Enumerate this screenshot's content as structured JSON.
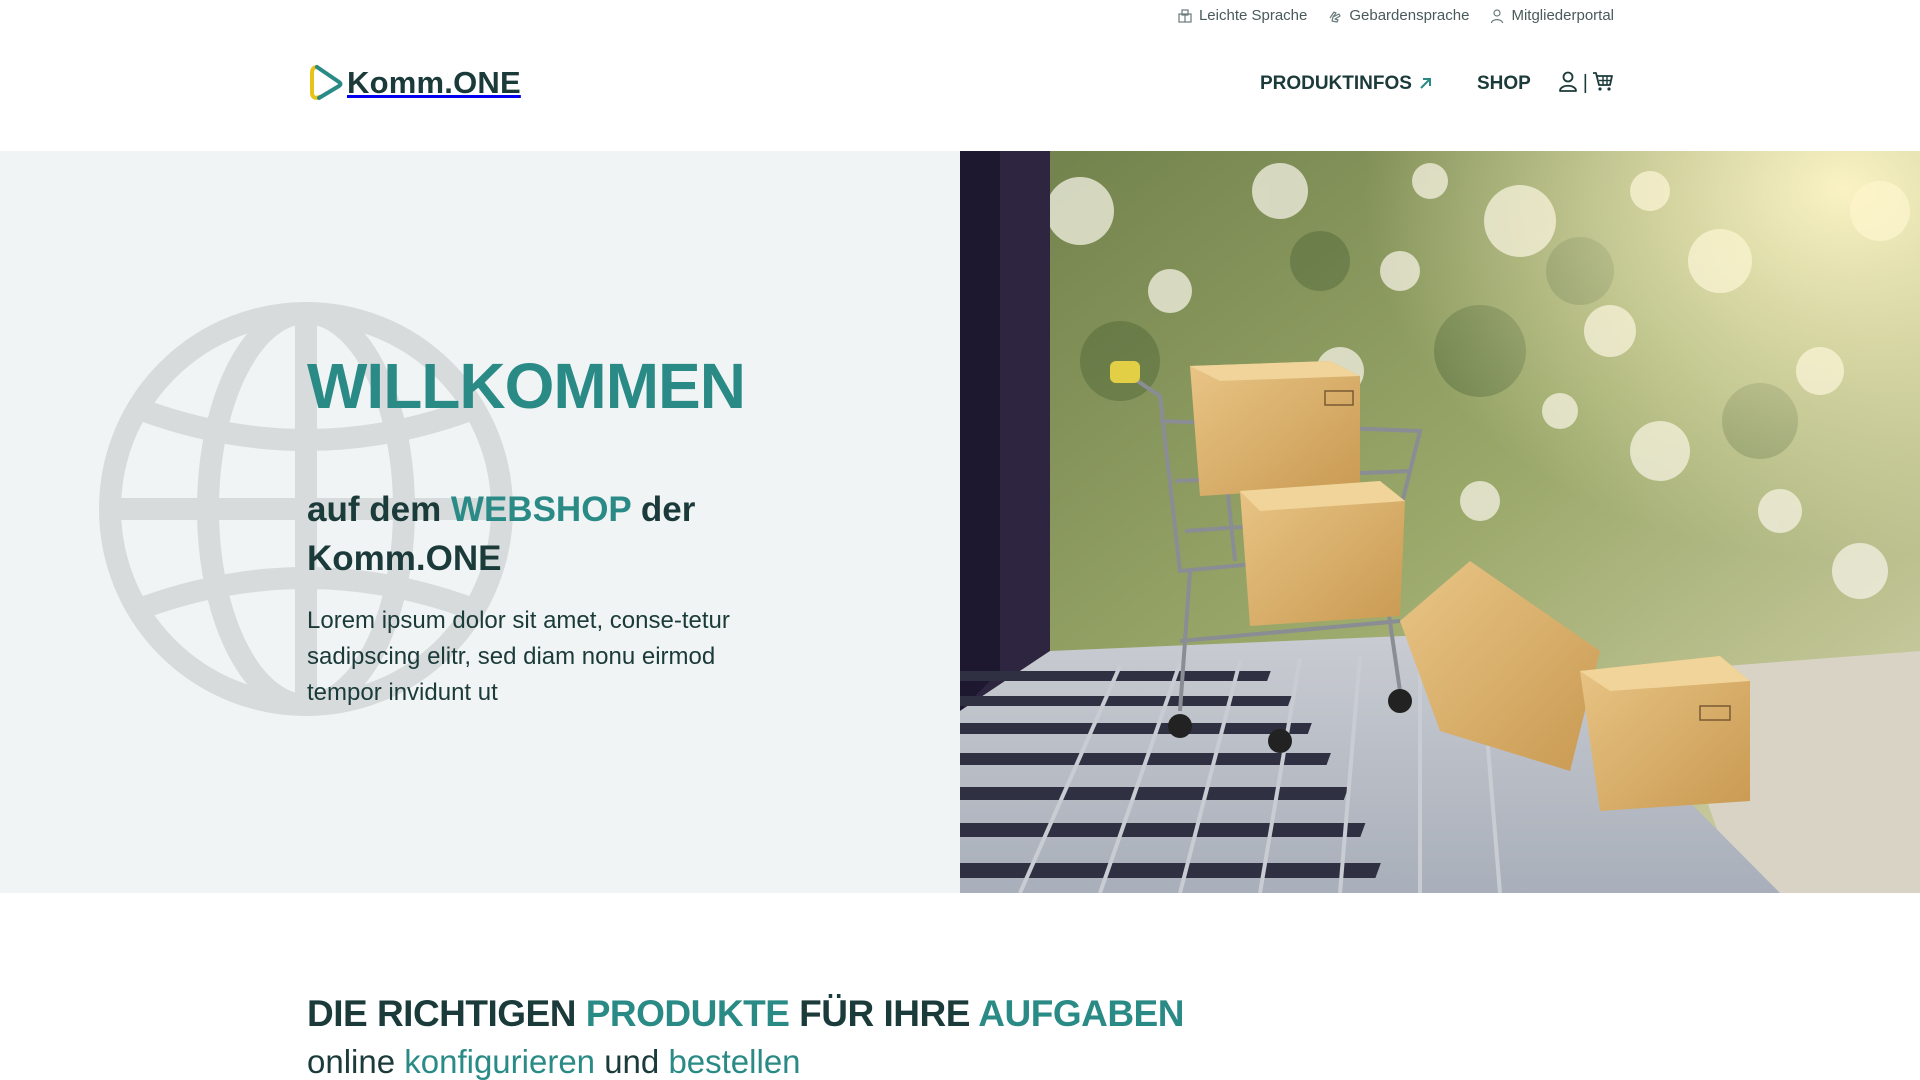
{
  "utility_nav": {
    "leichte_sprache": "Leichte Sprache",
    "gebaerdensprache": "Gebardensprache",
    "mitgliederportal": "Mitgliederportal"
  },
  "header": {
    "logo_text": "Komm.ONE",
    "nav": {
      "produktinfos": "PRODUKTINFOS",
      "shop": "SHOP",
      "separator": "|"
    }
  },
  "hero": {
    "title": "WILLKOMMEN",
    "subtitle_part1": "auf dem ",
    "subtitle_accent": "WEBSHOP",
    "subtitle_part2": " der Komm.ONE",
    "body": "Lorem ipsum dolor sit amet, conse-tetur sadipscing elitr, sed diam nonu eirmod tempor invidunt ut"
  },
  "section": {
    "title_part1": "DIE RICHTIGEN ",
    "title_accent1": "PRODUKTE",
    "title_part2": " FÜR IHRE ",
    "title_accent2": "AUFGABEN",
    "sub_part1": "online ",
    "sub_accent1": "konfigurieren",
    "sub_part2": " und ",
    "sub_accent2": "bestellen"
  },
  "colors": {
    "accent": "#2a8a86",
    "dark": "#1b3a3a",
    "hero_bg": "#f1f4f5",
    "logo_yellow": "#e8c41a"
  },
  "icons": [
    "easy-read-icon",
    "sign-language-icon",
    "user-icon",
    "external-link-icon",
    "cart-icon",
    "globe-icon",
    "logo-play-icon"
  ]
}
